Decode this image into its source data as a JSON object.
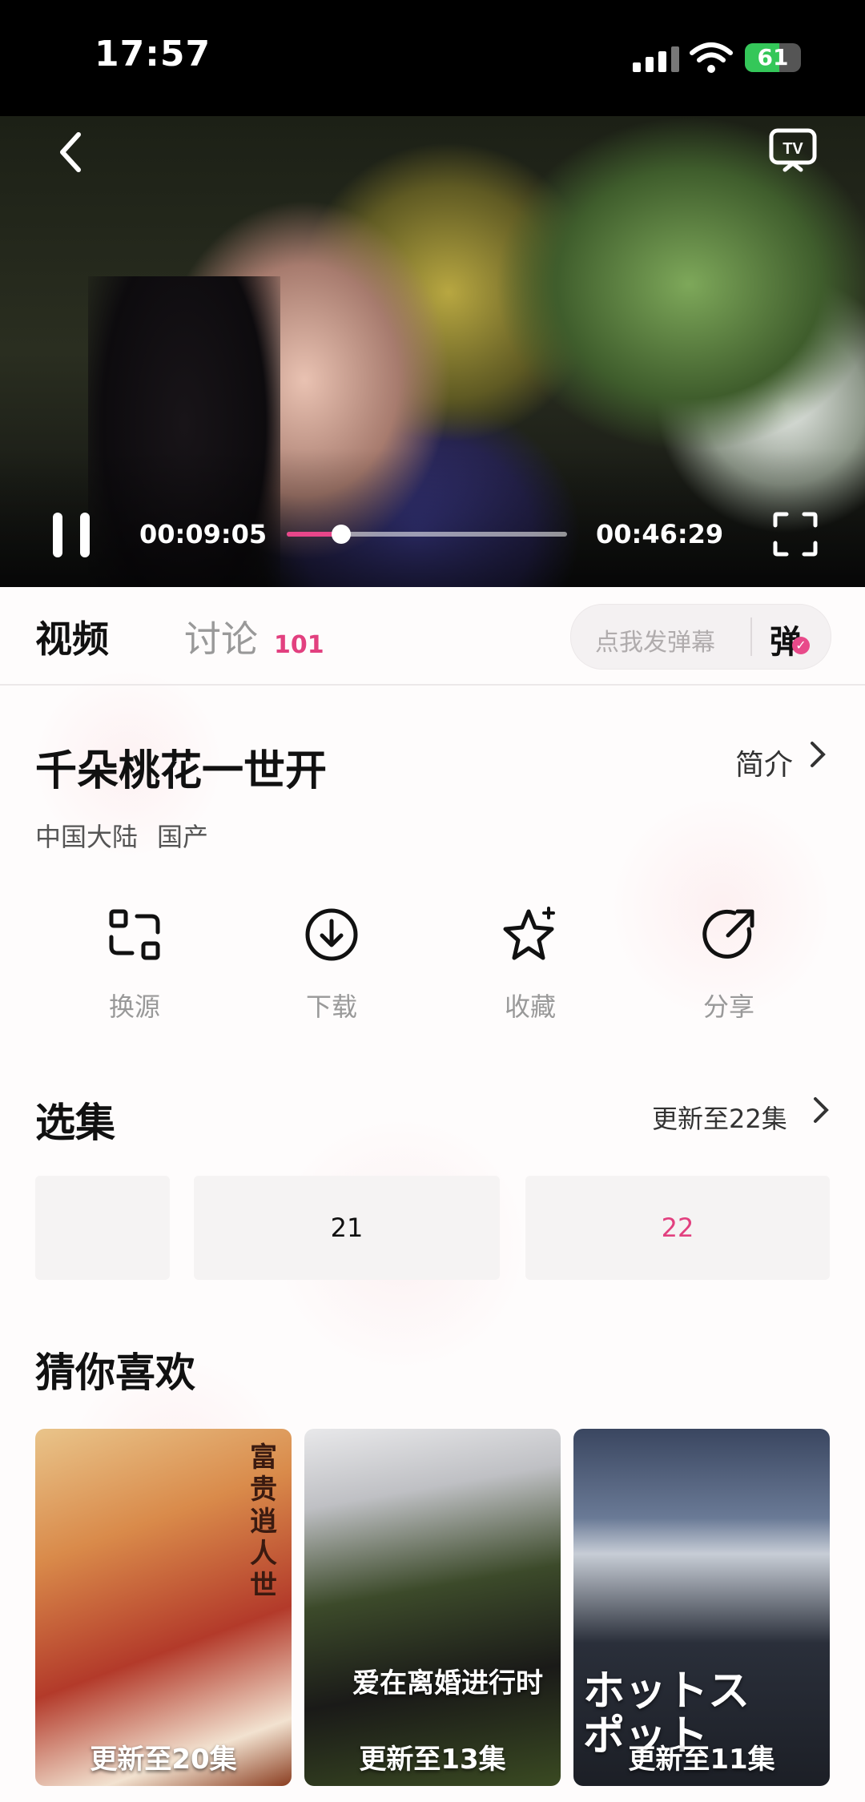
{
  "status_bar": {
    "time": "17:57",
    "battery_level": "61",
    "battery_percent": 61,
    "icons": [
      "signal-icon",
      "wifi-icon",
      "battery-charging-icon"
    ]
  },
  "player": {
    "current_time": "00:09:05",
    "total_time": "00:46:29",
    "progress_fraction": 0.195,
    "icons": [
      "back-icon",
      "tv-cast-icon",
      "pause-icon",
      "fullscreen-icon"
    ]
  },
  "tabs": {
    "video_label": "视频",
    "discuss_label": "讨论",
    "discuss_count": "101"
  },
  "danmaku": {
    "placeholder": "点我发弹幕",
    "toggle_label": "弹"
  },
  "show": {
    "title": "千朵桃花一世开",
    "intro_label": "简介",
    "region": "中国大陆",
    "category": "国产"
  },
  "actions": [
    {
      "label": "换源",
      "icon": "switch-source-icon"
    },
    {
      "label": "下载",
      "icon": "download-icon"
    },
    {
      "label": "收藏",
      "icon": "favorite-star-icon"
    },
    {
      "label": "分享",
      "icon": "share-icon"
    }
  ],
  "episodes": {
    "title": "选集",
    "update_label": "更新至22集",
    "items": [
      {
        "label": "",
        "active": false
      },
      {
        "label": "21",
        "active": false
      },
      {
        "label": "22",
        "active": true
      }
    ]
  },
  "recommend": {
    "title": "猜你喜欢",
    "items": [
      {
        "caption": "更新至20集",
        "art_text": "富贵逍人世"
      },
      {
        "caption": "更新至13集",
        "art_text": "爱在离婚进行时"
      },
      {
        "caption": "更新至11集",
        "art_text": "ホットスポット"
      }
    ]
  },
  "colors": {
    "accent": "#e2407f",
    "text_primary": "#111111",
    "text_muted": "#999999"
  }
}
